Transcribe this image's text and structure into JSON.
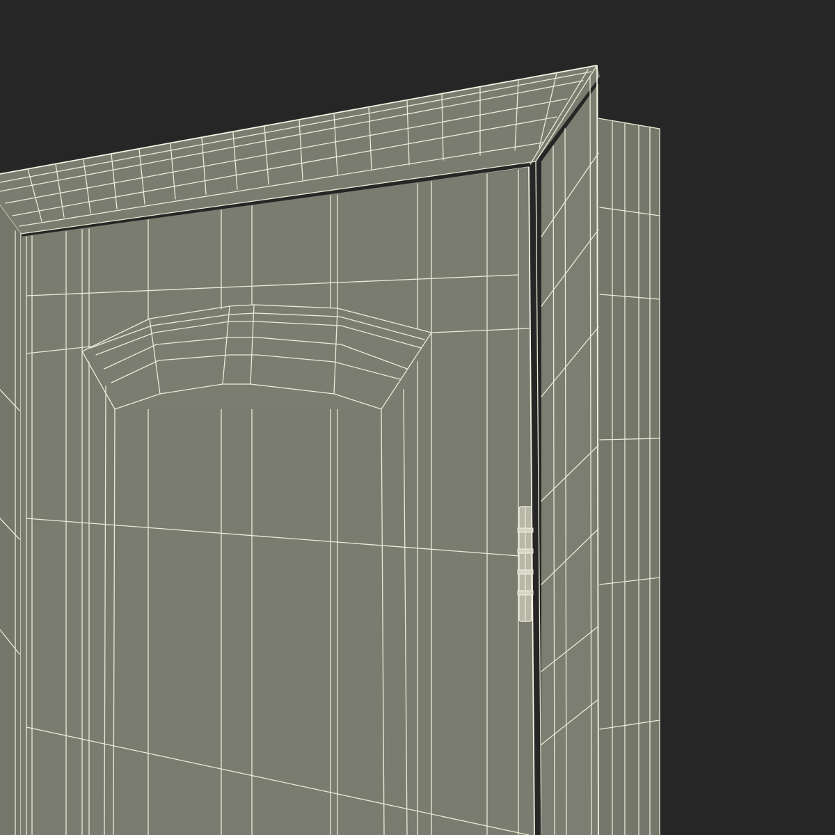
{
  "scene": {
    "subject": "door-panel-wireframe",
    "background_color": "#262626",
    "surface_color": "#7b7c70",
    "side_color": "#76776b",
    "wire_color": "#ecebd8",
    "hinge_color": "#b8b7a8"
  }
}
